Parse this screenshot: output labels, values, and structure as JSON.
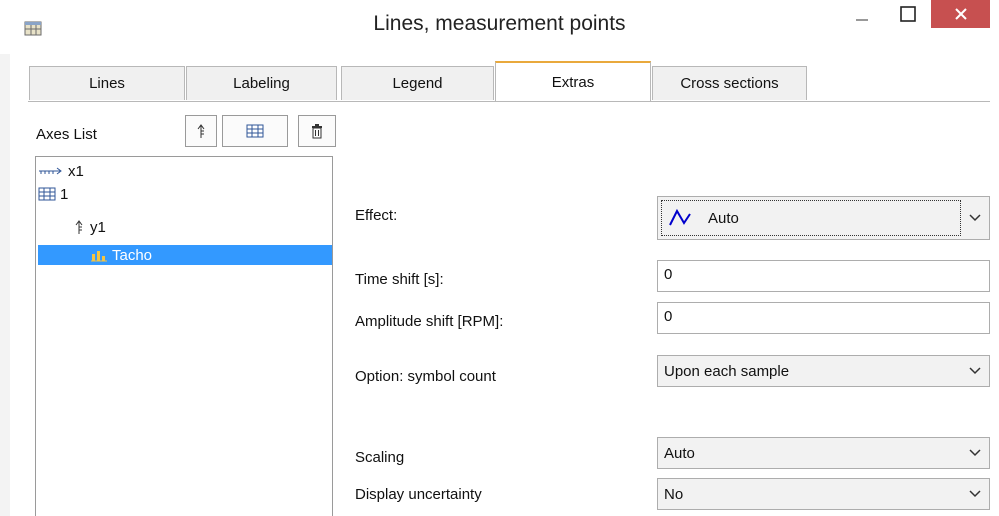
{
  "window": {
    "title": "Lines, measurement points"
  },
  "tabs": [
    {
      "label": "Lines"
    },
    {
      "label": "Labeling"
    },
    {
      "label": "Legend"
    },
    {
      "label": "Extras"
    },
    {
      "label": "Cross sections"
    }
  ],
  "active_tab": "Extras",
  "axes_panel": {
    "label": "Axes List",
    "tree": [
      {
        "label": "x1",
        "icon": "x-axis-icon"
      },
      {
        "label": "1",
        "icon": "grid-icon"
      },
      {
        "label": "y1",
        "icon": "y-axis-icon"
      },
      {
        "label": "Tacho",
        "icon": "bar-chart-icon",
        "selected": true
      }
    ]
  },
  "form": {
    "effect": {
      "label": "Effect:",
      "value": "Auto"
    },
    "time_shift": {
      "label": "Time shift [s]:",
      "value": "0"
    },
    "amplitude_shift": {
      "label": "Amplitude shift [RPM]:",
      "value": "0"
    },
    "symbol_count": {
      "label": "Option: symbol count",
      "value": "Upon each sample"
    },
    "scaling": {
      "label": "Scaling",
      "value": "Auto"
    },
    "display_uncertainty": {
      "label": "Display uncertainty",
      "value": "No"
    }
  },
  "colors": {
    "accent_tab": "#e9a93c",
    "selection": "#3399ff",
    "close_button": "#c75050",
    "effect_wave": "#0000cc"
  }
}
